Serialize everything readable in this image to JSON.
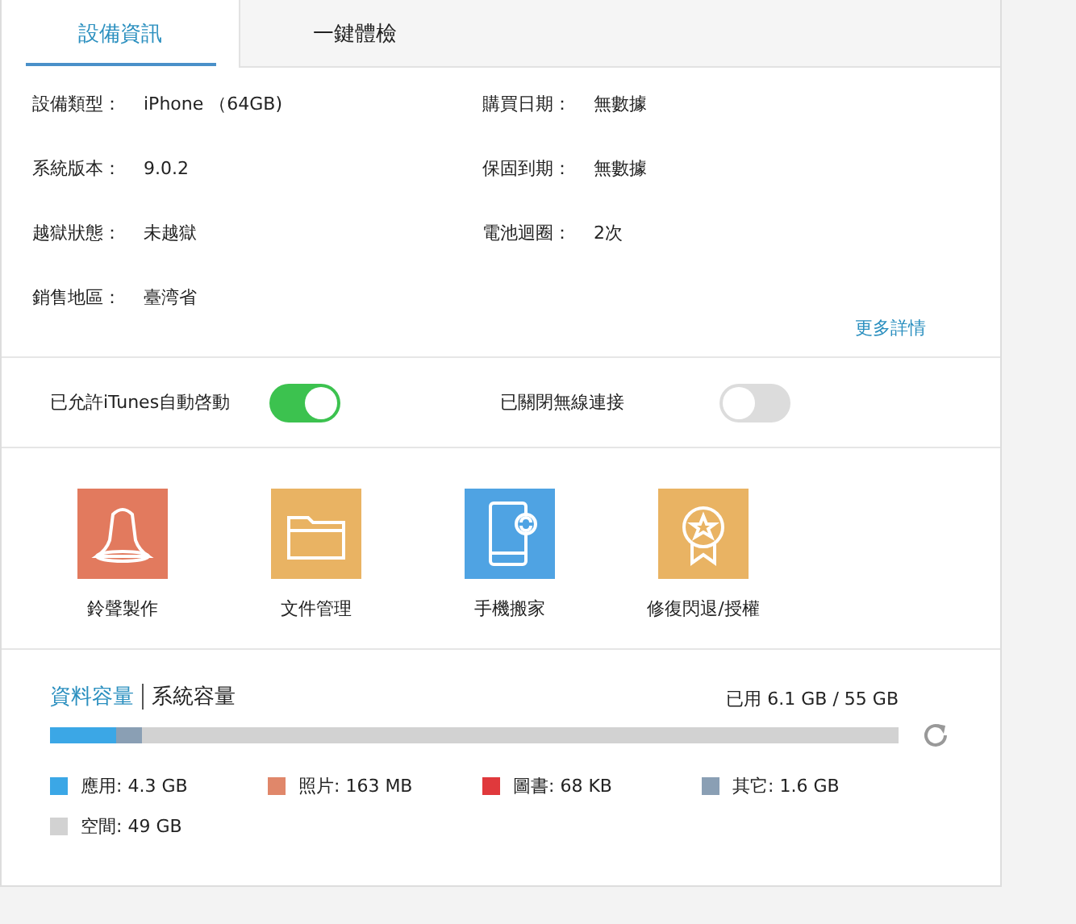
{
  "tabs": [
    {
      "label": "設備資訊",
      "selected": true
    },
    {
      "label": "一鍵體檢",
      "selected": false
    }
  ],
  "info": {
    "rows": [
      {
        "label": "設備類型：",
        "value": "iPhone （64GB)"
      },
      {
        "label": "購買日期：",
        "value": "無數據"
      },
      {
        "label": "系統版本：",
        "value": "9.0.2"
      },
      {
        "label": "保固到期：",
        "value": "無數據"
      },
      {
        "label": "越獄狀態：",
        "value": "未越獄"
      },
      {
        "label": "電池迴圈：",
        "value": "2次"
      },
      {
        "label": "銷售地區：",
        "value": "臺湾省"
      }
    ],
    "more_link": "更多詳情"
  },
  "toggles": [
    {
      "label": "已允許iTunes自動啓動",
      "on": true
    },
    {
      "label": "已關閉無線連接",
      "on": false
    }
  ],
  "tools": [
    {
      "kind": "bell",
      "label": "鈴聲製作",
      "color": "#e27a5e"
    },
    {
      "kind": "folder",
      "label": "文件管理",
      "color": "#e9b363"
    },
    {
      "kind": "phone",
      "label": "手機搬家",
      "color": "#4fa3e3"
    },
    {
      "kind": "badge",
      "label": "修復閃退/授權",
      "color": "#e9b363"
    }
  ],
  "storage": {
    "tabs": [
      {
        "label": "資料容量",
        "selected": true
      },
      {
        "label": "系統容量",
        "selected": false
      }
    ],
    "used": "已用 6.1 GB / 55 GB",
    "segments": [
      {
        "color": "#3ba7e6",
        "level": 0.077
      },
      {
        "color": "#8a9fb4",
        "level": 0.032
      }
    ],
    "legend": [
      {
        "label": "應用: 4.3 GB",
        "color": "#3ba7e6"
      },
      {
        "label": "照片: 163 MB",
        "color": "#e0876a"
      },
      {
        "label": "圖書: 68 KB",
        "color": "#e0393c"
      },
      {
        "label": "其它: 1.6 GB",
        "color": "#8a9fb4"
      },
      {
        "label": "空間: 49 GB",
        "color": "#d2d2d2"
      }
    ]
  }
}
